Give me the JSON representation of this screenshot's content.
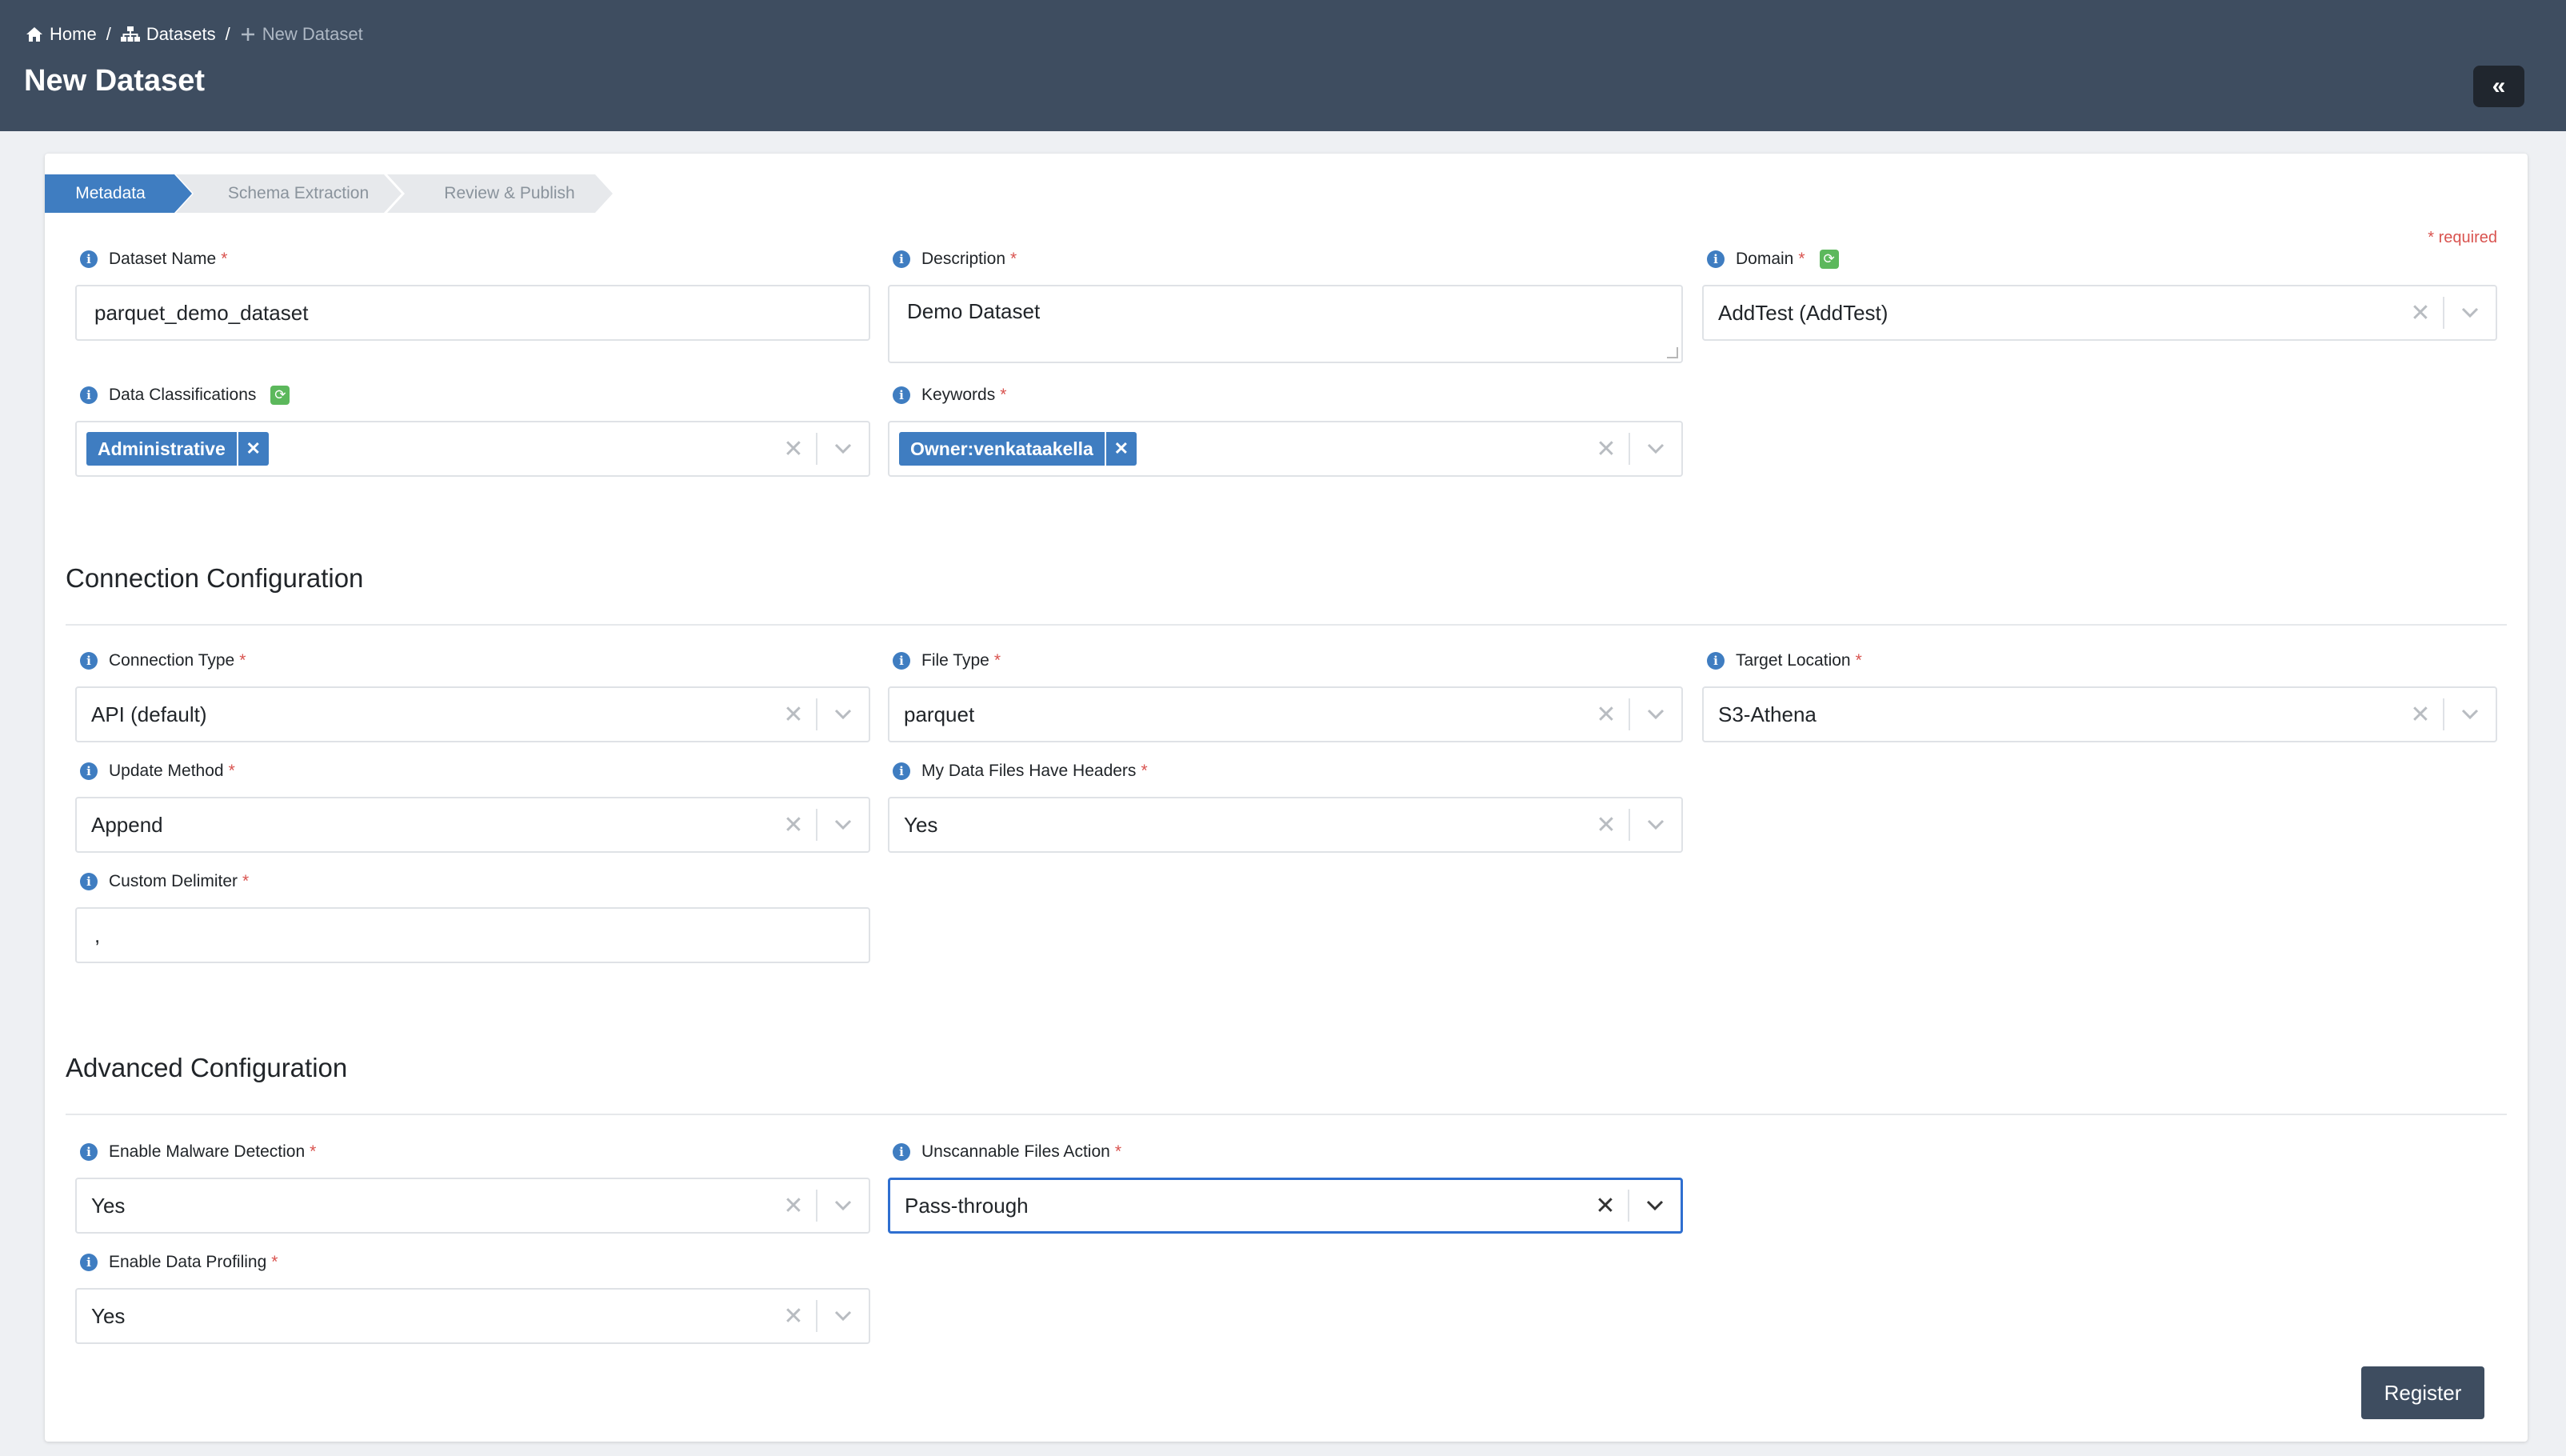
{
  "breadcrumb": {
    "home": "Home",
    "sep1": "/",
    "datasets": "Datasets",
    "sep2": "/",
    "current": "New Dataset"
  },
  "page_title": "New Dataset",
  "collapse_label": "«",
  "steps": [
    "Metadata",
    "Schema Extraction",
    "Review & Publish"
  ],
  "required_note": "* required",
  "metadata": {
    "dataset_name": {
      "label": "Dataset Name",
      "value": "parquet_demo_dataset"
    },
    "description": {
      "label": "Description",
      "value": "Demo Dataset"
    },
    "domain": {
      "label": "Domain",
      "value": "AddTest (AddTest)"
    },
    "data_classifications": {
      "label": "Data Classifications",
      "tag": "Administrative"
    },
    "keywords": {
      "label": "Keywords",
      "tag": "Owner:venkataakella"
    }
  },
  "connection": {
    "title": "Connection Configuration",
    "connection_type": {
      "label": "Connection Type",
      "value": "API (default)"
    },
    "file_type": {
      "label": "File Type",
      "value": "parquet"
    },
    "target_location": {
      "label": "Target Location",
      "value": "S3-Athena"
    },
    "update_method": {
      "label": "Update Method",
      "value": "Append"
    },
    "headers": {
      "label": "My Data Files Have Headers",
      "value": "Yes"
    },
    "delimiter": {
      "label": "Custom Delimiter",
      "value": ","
    }
  },
  "advanced": {
    "title": "Advanced Configuration",
    "malware": {
      "label": "Enable Malware Detection",
      "value": "Yes"
    },
    "unscannable": {
      "label": "Unscannable Files Action",
      "value": "Pass-through"
    },
    "profiling": {
      "label": "Enable Data Profiling",
      "value": "Yes"
    }
  },
  "register_label": "Register",
  "icons": {
    "info": "info-circle-icon",
    "refresh": "refresh-icon",
    "clear": "close-icon",
    "dropdown": "chevron-down-icon"
  },
  "colors": {
    "header_bg": "#3e4d60",
    "accent": "#3f7dc1",
    "required": "#d9534f",
    "focus": "#2f6fd0"
  }
}
